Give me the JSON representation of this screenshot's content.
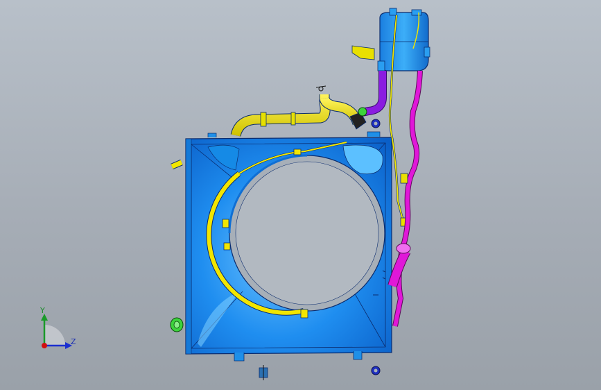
{
  "viewport": {
    "background": "#a9b0b8"
  },
  "triad": {
    "y_label": "Y",
    "z_label": "Z",
    "y_color": "#1a9a2a",
    "z_color": "#1b2fd0",
    "origin_color": "#d01010"
  },
  "parts": {
    "shroud_color": "#1e8fe8",
    "upper_hose_color": "#f2e600",
    "overflow_hose_color": "#e018d8",
    "reservoir_color": "#2a9ef0",
    "outlet_elbow_color": "#8a1ce0",
    "clip_color": "#1e2fbf",
    "bracket_color": "#e9e000",
    "fitting_color": "#3cd23c"
  }
}
